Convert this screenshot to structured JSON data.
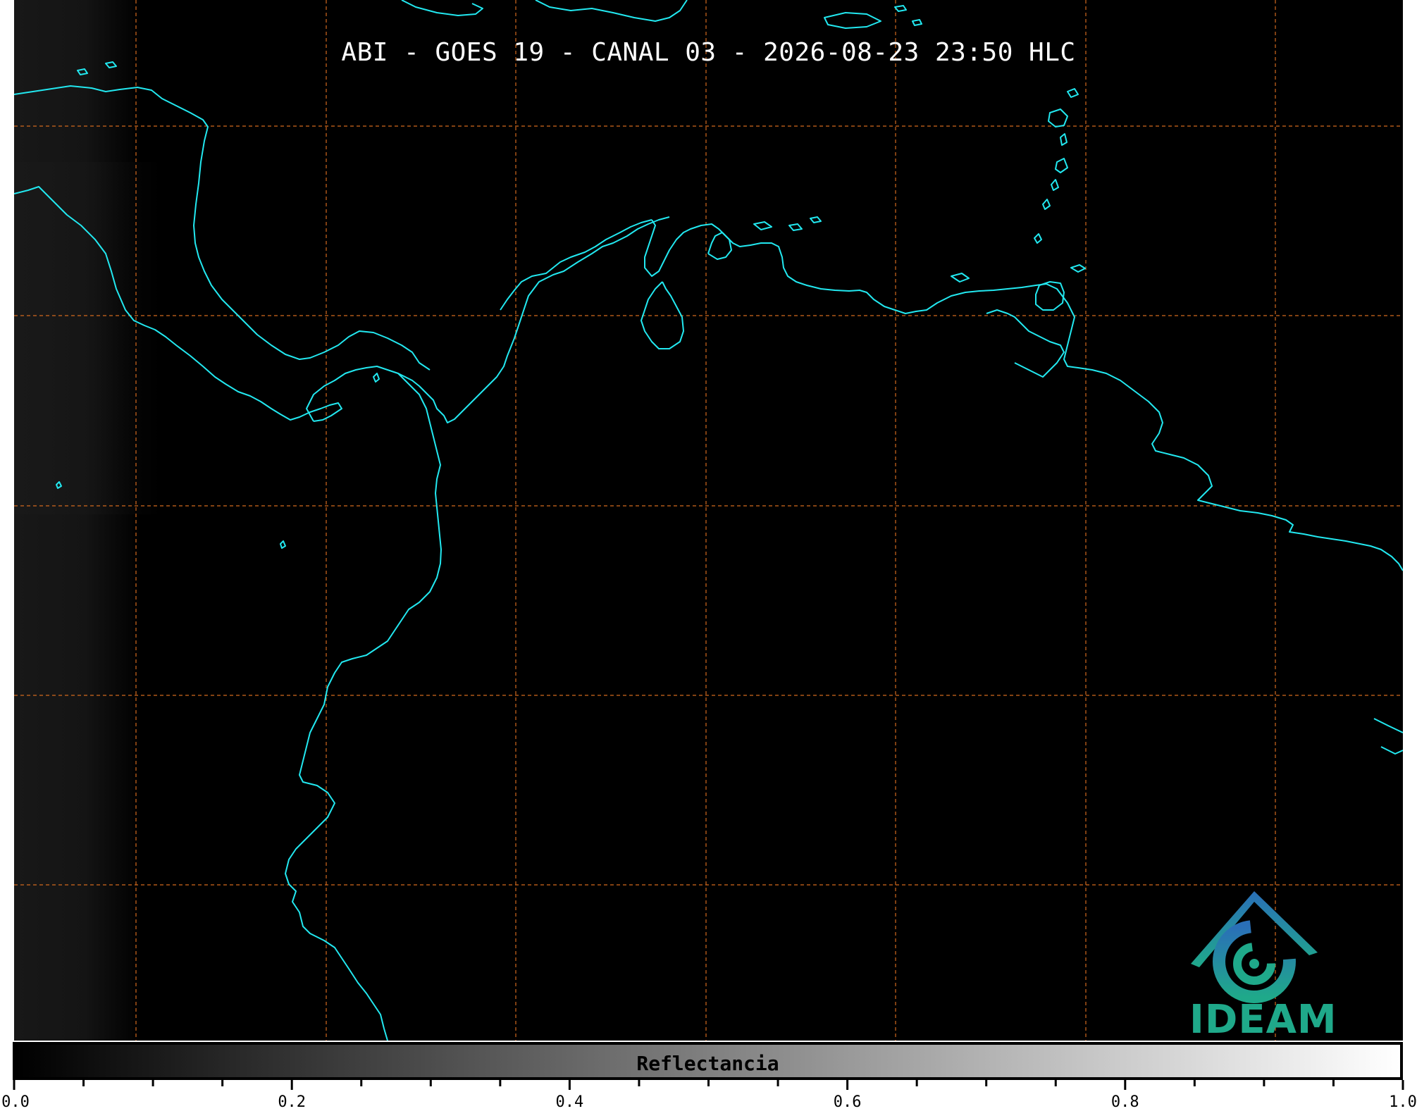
{
  "title": "ABI - GOES 19 - CANAL 03 - 2026-08-23 23:50 HLC",
  "colorbar": {
    "label": "Reflectancia",
    "min": 0.0,
    "max": 1.0,
    "major_ticks": [
      "0.0",
      "0.2",
      "0.4",
      "0.6",
      "0.8",
      "1.0"
    ],
    "colormap": [
      "#000000",
      "#ffffff"
    ]
  },
  "logo": {
    "text": "IDEAM",
    "icon": "ideam-mountain-swirl-icon"
  },
  "colors": {
    "coastline": "#22e8f0",
    "gridline": "#d2691e",
    "background": "#000000"
  }
}
